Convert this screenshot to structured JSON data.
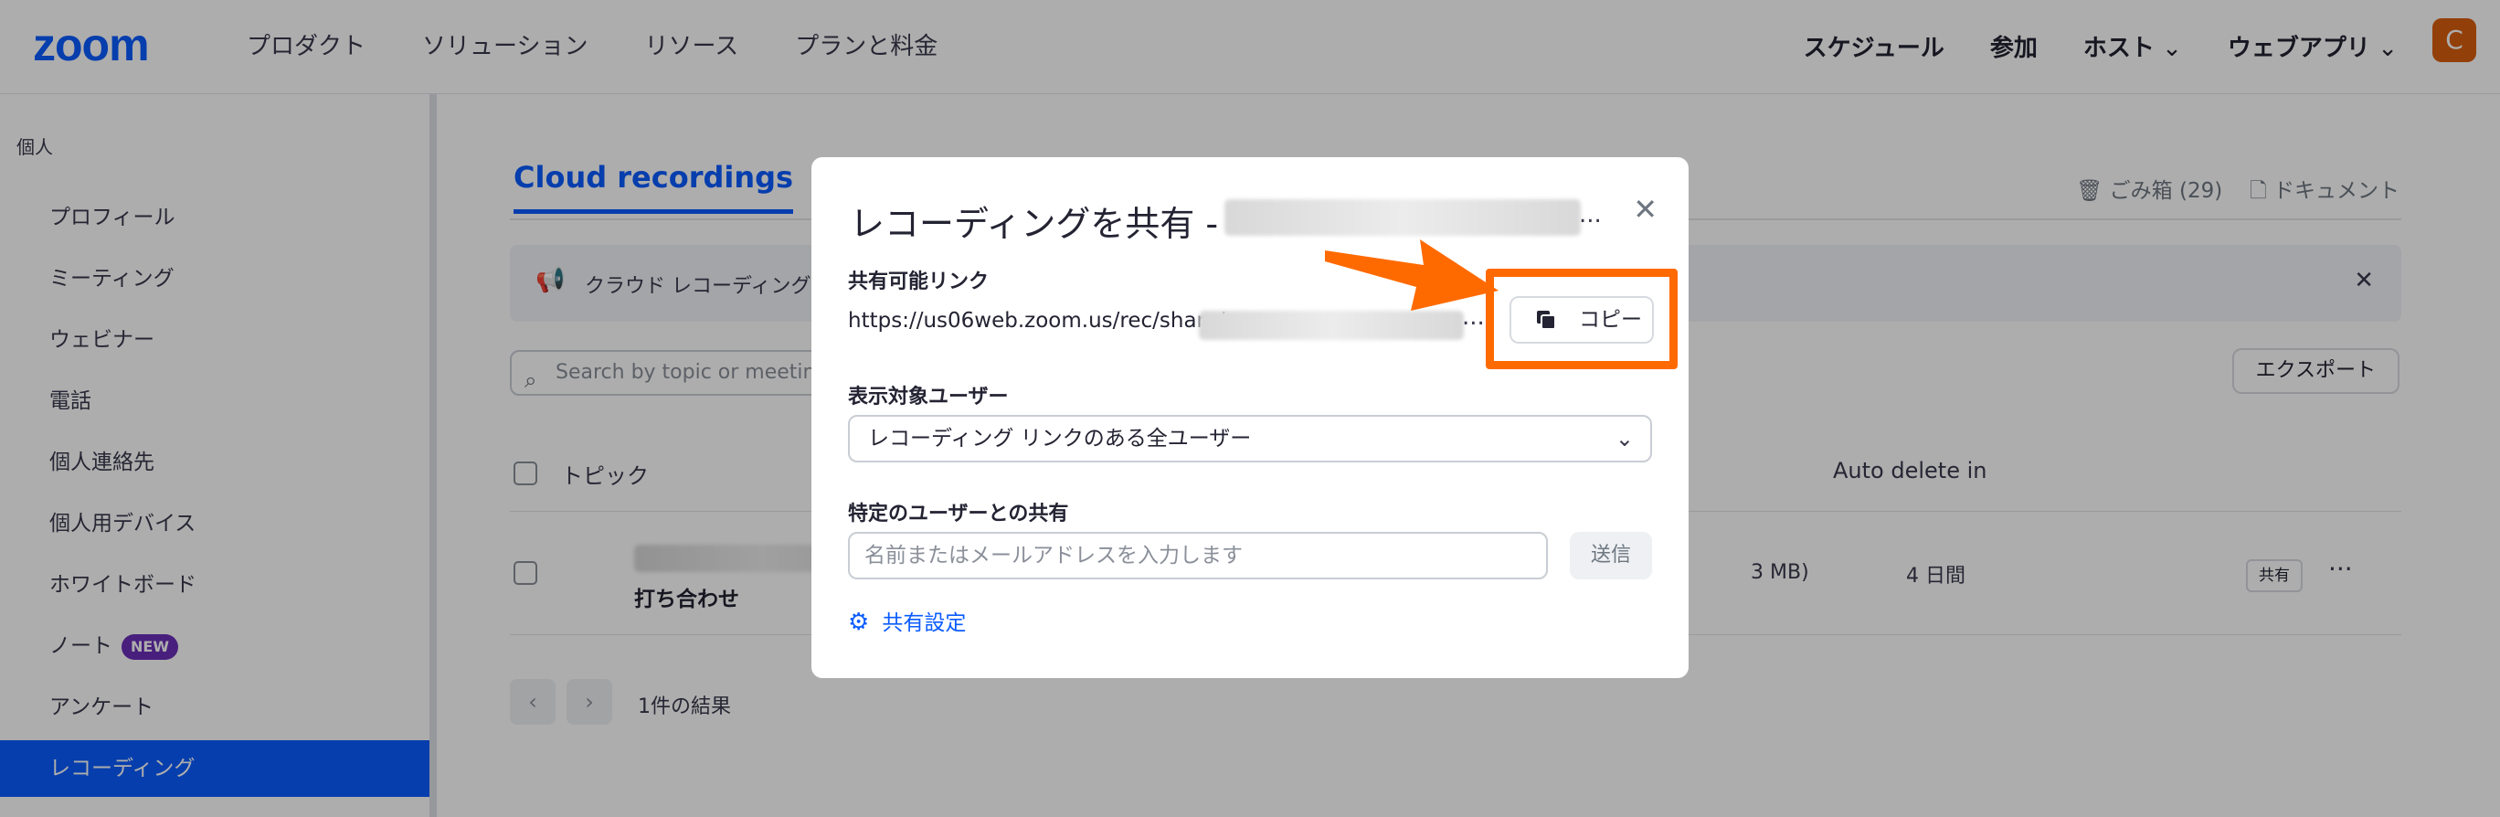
{
  "header": {
    "logo": "zoom",
    "nav_left": [
      "プロダクト",
      "ソリューション",
      "リソース",
      "プランと料金"
    ],
    "nav_right": {
      "schedule": "スケジュール",
      "join": "参加",
      "host": "ホスト",
      "web_app": "ウェブアプリ"
    },
    "avatar_initial": "C"
  },
  "sidebar": {
    "heading": "個人",
    "items": [
      {
        "label": "プロフィール"
      },
      {
        "label": "ミーティング"
      },
      {
        "label": "ウェビナー"
      },
      {
        "label": "電話"
      },
      {
        "label": "個人連絡先"
      },
      {
        "label": "個人用デバイス"
      },
      {
        "label": "ホワイトボード"
      },
      {
        "label": "ノート",
        "badge": "NEW"
      },
      {
        "label": "アンケート"
      },
      {
        "label": "レコーディング",
        "active": true
      }
    ]
  },
  "main": {
    "tab_active": "Cloud recordings",
    "trash": "ごみ箱 (29)",
    "documents": "ドキュメント",
    "banner_text": "クラウド レコーディング",
    "search_placeholder": "Search by topic or meeting",
    "export": "エクスポート",
    "columns": {
      "topic": "トピック",
      "auto_delete": "Auto delete in"
    },
    "row": {
      "title": "打ち合わせ",
      "size_fragment": "3 MB)",
      "auto_delete": "4 日間",
      "share_chip": "共有",
      "more": "···"
    },
    "pager": {
      "prev": "‹",
      "next": "›",
      "results": "1件の結果"
    }
  },
  "modal": {
    "title": "レコーディングを共有 -",
    "title_ellipsis": "...",
    "close": "✕",
    "shareable_link_label": "共有可能リンク",
    "link_prefix": "https://us06web.zoom.us/rec/share/",
    "link_ellipsis": "...",
    "copy_button": "コピー",
    "audience_label": "表示対象ユーザー",
    "audience_value": "レコーディング リンクのある全ユーザー",
    "specific_users_label": "特定のユーザーとの共有",
    "name_placeholder": "名前またはメールアドレスを入力します",
    "send": "送信",
    "share_settings": "共有設定"
  },
  "colors": {
    "brand_blue": "#0b5cff",
    "highlight_orange": "#ff6a00",
    "avatar": "#d95e0e"
  },
  "icons": [
    "search-icon",
    "megaphone-icon",
    "close-icon",
    "copy-icon",
    "chevron-down-icon",
    "gear-icon",
    "trash-icon",
    "document-icon",
    "arrow-annotation"
  ]
}
